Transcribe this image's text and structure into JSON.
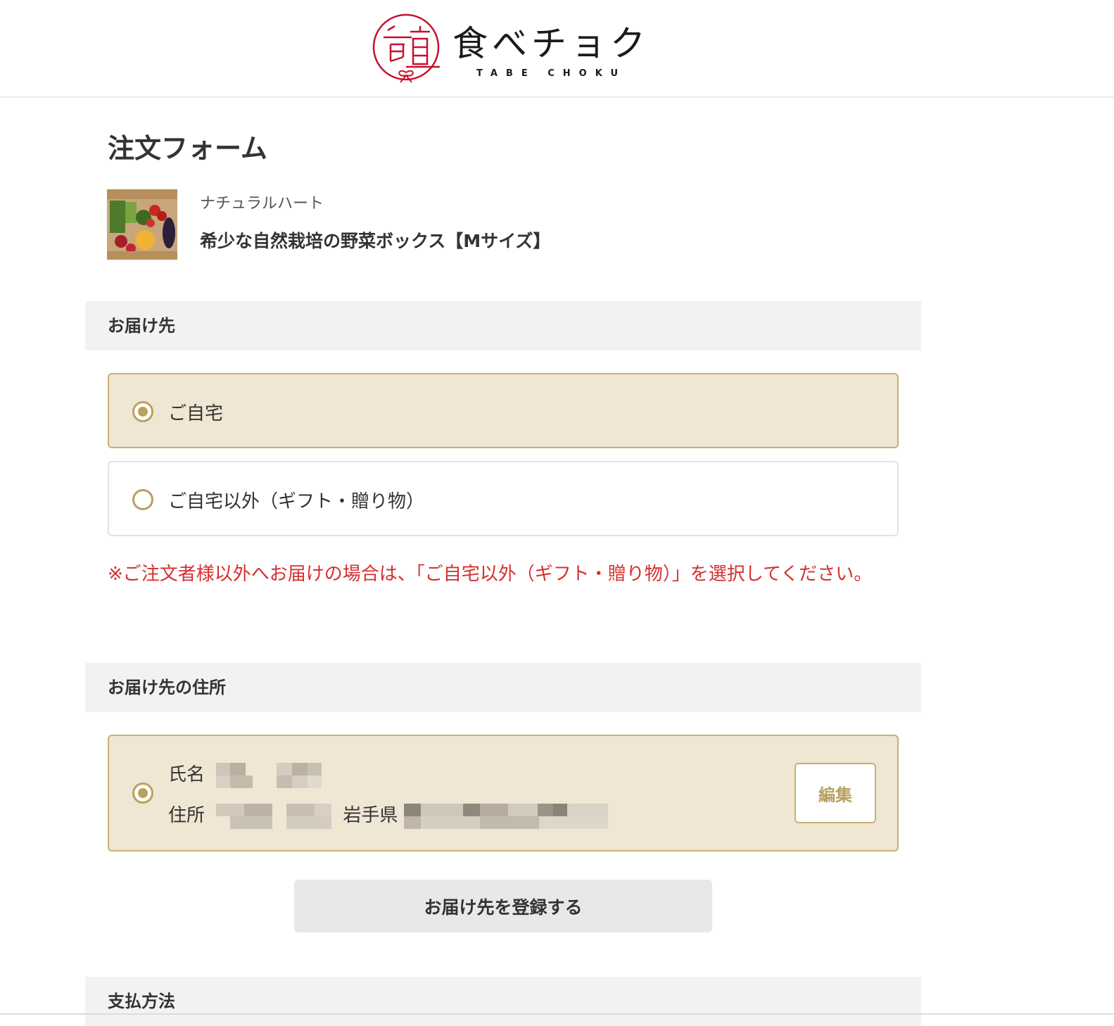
{
  "header": {
    "logo_text": "食べチョク",
    "logo_subtext": "TABE CHOKU",
    "brand_color": "#c8102e"
  },
  "page": {
    "title": "注文フォーム"
  },
  "product": {
    "shop_name": "ナチュラルハート",
    "name": "希少な自然栽培の野菜ボックス【Mサイズ】"
  },
  "delivery": {
    "section_title": "お届け先",
    "options": [
      {
        "label": "ご自宅",
        "selected": true
      },
      {
        "label": "ご自宅以外（ギフト・贈り物）",
        "selected": false
      }
    ],
    "note": "※ご注文者様以外へお届けの場合は、「ご自宅以外（ギフト・贈り物）」を選択してください。"
  },
  "address": {
    "section_title": "お届け先の住所",
    "name_label": "氏名",
    "address_label": "住所",
    "address_prefecture": "岩手県",
    "edit_label": "編集",
    "register_label": "お届け先を登録する"
  },
  "payment": {
    "section_title": "支払方法"
  },
  "colors": {
    "accent_gold": "#b9a15e",
    "selected_bg": "#f0e6d4",
    "note_red": "#d62f2f",
    "section_bg": "#f2f2f2"
  }
}
